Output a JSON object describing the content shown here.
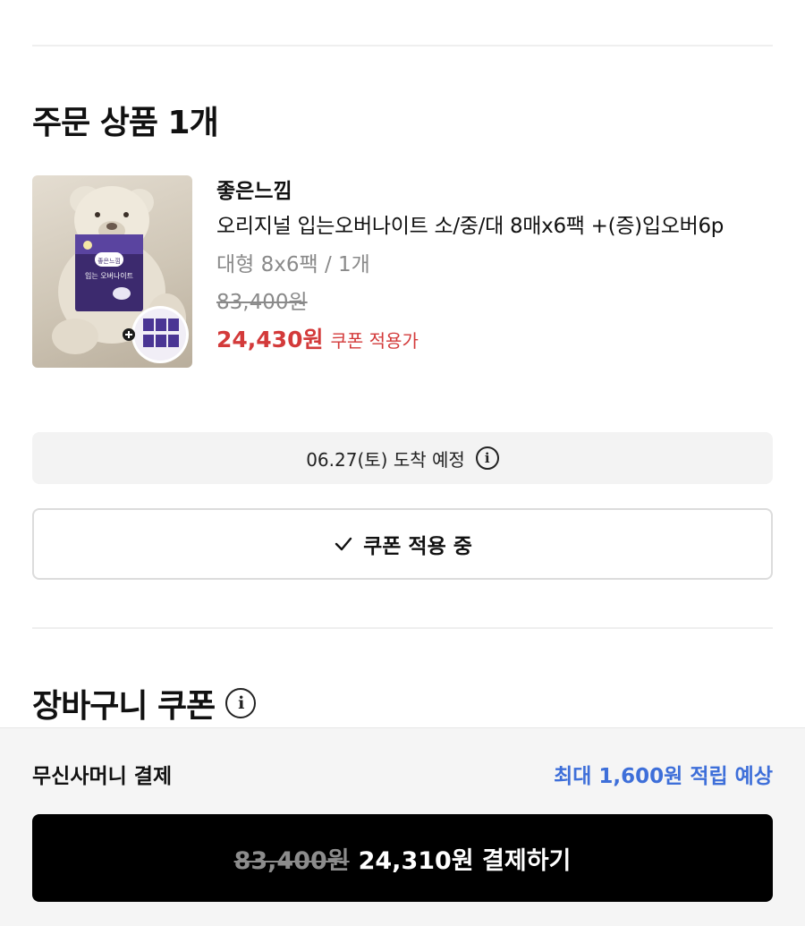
{
  "order": {
    "title": "주문 상품 1개",
    "product": {
      "brand": "좋은느낌",
      "name": "오리지널 입는오버나이트 소/중/대 8매x6팩 +(증)입오버6p",
      "option": "대형 8x6팩 / 1개",
      "original_price": "83,400원",
      "sale_price": "24,430원",
      "sale_note": "쿠폰 적용가",
      "package_brand": "좋은느낌",
      "package_label": "입는 오버나이트"
    },
    "delivery": {
      "text": "06.27(토) 도착 예정"
    },
    "coupon_button": {
      "label": "쿠폰 적용 중"
    }
  },
  "cart_coupon": {
    "title": "장바구니 쿠폰"
  },
  "payment": {
    "label": "무신사머니 결제",
    "reward": "최대 1,600원 적립 예상",
    "button": {
      "original": "83,400원",
      "final": "24,310원 결제하기"
    }
  },
  "colors": {
    "sale": "#d33a3a",
    "reward": "#3e6fd9",
    "pay_button": "#000000"
  },
  "icons": [
    "info-icon",
    "check-icon",
    "plus-icon"
  ]
}
